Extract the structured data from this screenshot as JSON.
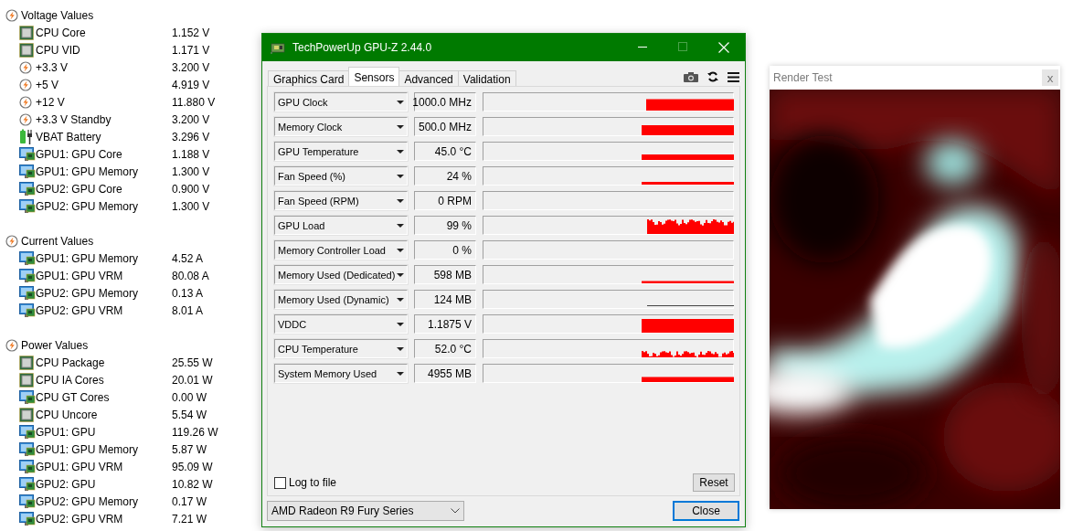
{
  "sensor_list": {
    "sections": [
      {
        "title": "Voltage Values",
        "rows": [
          {
            "kind": "chip",
            "label": "CPU Core",
            "value": "1.152 V"
          },
          {
            "kind": "chip",
            "label": "CPU VID",
            "value": "1.171 V"
          },
          {
            "kind": "bolt",
            "label": "+3.3 V",
            "value": "3.200 V"
          },
          {
            "kind": "bolt",
            "label": "+5 V",
            "value": "4.919 V"
          },
          {
            "kind": "bolt",
            "label": "+12 V",
            "value": "11.880 V"
          },
          {
            "kind": "bolt",
            "label": "+3.3 V Standby",
            "value": "3.200 V"
          },
          {
            "kind": "battery",
            "label": "VBAT Battery",
            "value": "3.296 V"
          },
          {
            "kind": "gpu",
            "label": "GPU1: GPU Core",
            "value": "1.188 V"
          },
          {
            "kind": "gpu",
            "label": "GPU1: GPU Memory",
            "value": "1.300 V"
          },
          {
            "kind": "gpu",
            "label": "GPU2: GPU Core",
            "value": "0.900 V"
          },
          {
            "kind": "gpu",
            "label": "GPU2: GPU Memory",
            "value": "1.300 V"
          }
        ]
      },
      {
        "title": "Current Values",
        "rows": [
          {
            "kind": "gpu",
            "label": "GPU1: GPU Memory",
            "value": "4.52 A"
          },
          {
            "kind": "gpu",
            "label": "GPU1: GPU VRM",
            "value": "80.08 A"
          },
          {
            "kind": "gpu",
            "label": "GPU2: GPU Memory",
            "value": "0.13 A"
          },
          {
            "kind": "gpu",
            "label": "GPU2: GPU VRM",
            "value": "8.01 A"
          }
        ]
      },
      {
        "title": "Power Values",
        "rows": [
          {
            "kind": "chip",
            "label": "CPU Package",
            "value": "25.55 W"
          },
          {
            "kind": "chip",
            "label": "CPU IA Cores",
            "value": "20.01 W"
          },
          {
            "kind": "gpu",
            "label": "CPU GT Cores",
            "value": "0.00 W"
          },
          {
            "kind": "chip",
            "label": "CPU Uncore",
            "value": "5.54 W"
          },
          {
            "kind": "gpu",
            "label": "GPU1: GPU",
            "value": "119.26 W"
          },
          {
            "kind": "gpu",
            "label": "GPU1: GPU Memory",
            "value": "5.87 W"
          },
          {
            "kind": "gpu",
            "label": "GPU1: GPU VRM",
            "value": "95.09 W"
          },
          {
            "kind": "gpu",
            "label": "GPU2: GPU",
            "value": "10.82 W"
          },
          {
            "kind": "gpu",
            "label": "GPU2: GPU Memory",
            "value": "0.17 W"
          },
          {
            "kind": "gpu",
            "label": "GPU2: GPU VRM",
            "value": "7.21 W"
          }
        ]
      }
    ]
  },
  "gpuz": {
    "title": "TechPowerUp GPU-Z 2.44.0",
    "tabs": [
      {
        "label": "Graphics Card",
        "selected": false
      },
      {
        "label": "Sensors",
        "selected": true
      },
      {
        "label": "Advanced",
        "selected": false
      },
      {
        "label": "Validation",
        "selected": false
      }
    ],
    "sensors": [
      {
        "name": "GPU Clock",
        "value": "1000.0 MHz"
      },
      {
        "name": "Memory Clock",
        "value": "500.0 MHz"
      },
      {
        "name": "GPU Temperature",
        "value": "45.0 °C"
      },
      {
        "name": "Fan Speed (%)",
        "value": "24 %"
      },
      {
        "name": "Fan Speed (RPM)",
        "value": "0 RPM"
      },
      {
        "name": "GPU Load",
        "value": "99 %"
      },
      {
        "name": "Memory Controller Load",
        "value": "0 %"
      },
      {
        "name": "Memory Used (Dedicated)",
        "value": "598 MB"
      },
      {
        "name": "Memory Used (Dynamic)",
        "value": "124 MB"
      },
      {
        "name": "VDDC",
        "value": "1.1875 V"
      },
      {
        "name": "CPU Temperature",
        "value": "52.0 °C"
      },
      {
        "name": "System Memory Used",
        "value": "4955 MB"
      }
    ],
    "log_to_file": {
      "label": "Log to file",
      "checked": false
    },
    "reset_button": "Reset",
    "card_select": "AMD Radeon R9 Fury Series",
    "close_button": "Close"
  },
  "render_test": {
    "title": "Render Test",
    "close_label": "x"
  }
}
